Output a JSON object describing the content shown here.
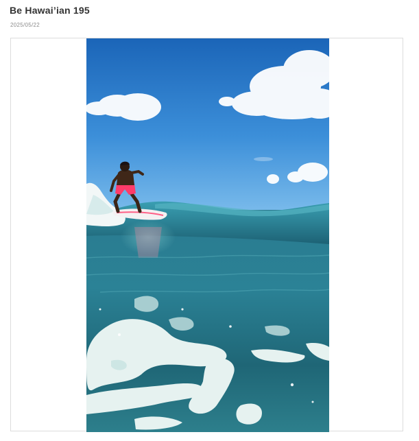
{
  "post": {
    "title": "Be Hawai’ian 195",
    "date": "2025/05/22"
  },
  "photo": {
    "subject": "surfer-riding-wave-photo",
    "colors": {
      "sky_top": "#1e6cc0",
      "sky_bottom": "#6db3ec",
      "ocean_dark": "#1f5f70",
      "ocean_light": "#3a94a6",
      "foam": "#e9f3f1",
      "shorts": "#ff3b6a",
      "board": "#f4f1f2"
    }
  }
}
